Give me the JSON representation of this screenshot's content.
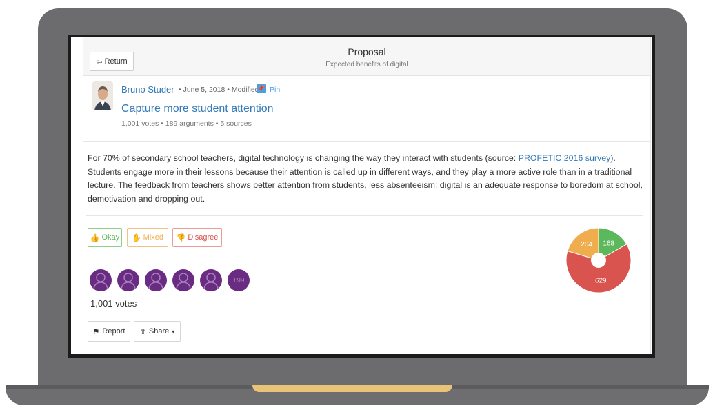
{
  "header": {
    "return_label": "Return",
    "title": "Proposal",
    "subtitle": "Expected benefits of digital"
  },
  "author": {
    "name": "Bruno Studer",
    "meta": "• June 5, 2018 • Modified",
    "pin_label": "Pin"
  },
  "proposal": {
    "title": "Capture more student attention",
    "stats": "1,001 votes • 189 arguments • 5 sources"
  },
  "body": {
    "text_before_link": "For 70% of secondary school teachers, digital technology is changing the way they interact with students (source: ",
    "link_text": "PROFETIC 2016 survey",
    "text_after_link": "). Students engage more in their lessons because their attention is called up in different ways, and they play a more active role than in a traditional lecture. The feedback from teachers shows better attention from students, less absenteeism: digital is an adequate response to boredom at school, demotivation and dropping out."
  },
  "vote_buttons": {
    "okay": "Okay",
    "mixed": "Mixed",
    "disagree": "Disagree"
  },
  "voters": {
    "more_label": "+99",
    "votes_count": "1,001 votes"
  },
  "actions": {
    "report": "Report",
    "share": "Share"
  },
  "colors": {
    "okay": "#5cb85c",
    "mixed": "#f0ad4e",
    "disagree": "#d9534f",
    "link": "#337ab7",
    "avatar": "#6a2c82"
  },
  "chart_data": {
    "type": "pie",
    "series": [
      {
        "name": "Okay",
        "value": 168,
        "color": "#5cb85c"
      },
      {
        "name": "Disagree",
        "value": 629,
        "color": "#d9534f"
      },
      {
        "name": "Mixed",
        "value": 204,
        "color": "#f0ad4e"
      }
    ]
  }
}
